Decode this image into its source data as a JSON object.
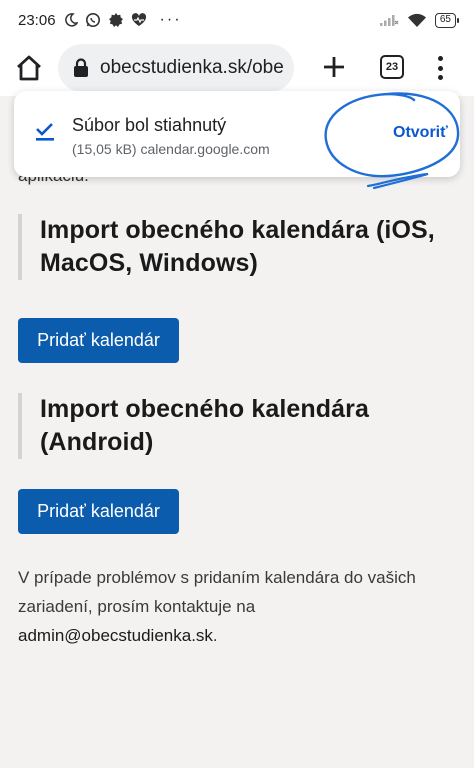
{
  "status_bar": {
    "time": "23:06",
    "battery": "65"
  },
  "browser": {
    "url": "obecstudienka.sk/obe",
    "tab_count": "23"
  },
  "download": {
    "title": "Súbor bol stiahnutý",
    "details": "(15,05 kB) calendar.google.com",
    "open_label": "Otvoriť"
  },
  "page": {
    "cut_text": "aplikáciu.",
    "sections": [
      {
        "heading": "Import obecného kalendára (iOS, MacOS, Windows)",
        "button_label": "Pridať kalendár"
      },
      {
        "heading": "Import obecného kalendára (Android)",
        "button_label": "Pridať kalendár"
      }
    ],
    "help_text_prefix": "V prípade problémov s pridaním kalendára do vašich zariadení, prosím kontaktuje na ",
    "help_email": "admin@obecstudienka.sk",
    "help_text_suffix": "."
  },
  "colors": {
    "accent": "#0b5cad",
    "link": "#0b57d0",
    "scribble": "#1f6fd6"
  }
}
